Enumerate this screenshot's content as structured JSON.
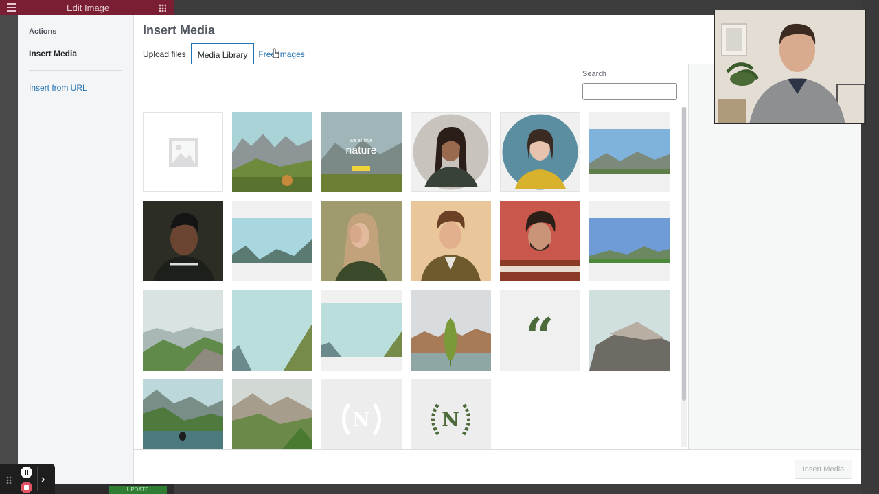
{
  "background_editor": {
    "title": "Edit Image",
    "update_label": "UPDATE"
  },
  "sidebar": {
    "section_title": "Actions",
    "active_item": "Insert Media",
    "items": [
      {
        "label": "Insert from URL"
      }
    ]
  },
  "header": {
    "title": "Insert Media"
  },
  "tabs": [
    {
      "label": "Upload files"
    },
    {
      "label": "Media Library"
    },
    {
      "label": "Free Images"
    }
  ],
  "search": {
    "label": "Search",
    "value": ""
  },
  "media_items": [
    {
      "name": "placeholder-image",
      "kind": "placeholder"
    },
    {
      "name": "mountain-valley",
      "kind": "landscape"
    },
    {
      "name": "we-all-love-nature-mockup",
      "kind": "mockup",
      "text_small": "we all love",
      "text_big": "nature"
    },
    {
      "name": "woman-portrait-circle",
      "kind": "portrait"
    },
    {
      "name": "woman-portrait-blue-circle",
      "kind": "portrait"
    },
    {
      "name": "mountain-sky-wide",
      "kind": "landscape"
    },
    {
      "name": "man-smiling-portrait",
      "kind": "portrait"
    },
    {
      "name": "mountain-range-wide",
      "kind": "landscape"
    },
    {
      "name": "woman-hand-face-portrait",
      "kind": "portrait"
    },
    {
      "name": "man-curly-hair-portrait",
      "kind": "portrait"
    },
    {
      "name": "man-beard-red-portrait",
      "kind": "portrait"
    },
    {
      "name": "green-hills-sky",
      "kind": "landscape"
    },
    {
      "name": "alpine-hills",
      "kind": "landscape"
    },
    {
      "name": "mountain-slopes-sky",
      "kind": "landscape"
    },
    {
      "name": "mountain-slopes-wide",
      "kind": "landscape"
    },
    {
      "name": "fern-leaf-lake",
      "kind": "landscape"
    },
    {
      "name": "quote-mark-graphic",
      "kind": "graphic",
      "text": "“"
    },
    {
      "name": "rocky-cliff-sea",
      "kind": "landscape"
    },
    {
      "name": "lake-mountains-person",
      "kind": "landscape"
    },
    {
      "name": "green-mountain-valley",
      "kind": "landscape"
    },
    {
      "name": "logo-n-white-wreath",
      "kind": "logo",
      "text": "N"
    },
    {
      "name": "logo-n-green-wreath",
      "kind": "logo",
      "text": "N"
    }
  ],
  "toolbar": {
    "insert_label": "Insert Media"
  },
  "colors": {
    "accent": "#2271b1",
    "logo_green": "#4d6b3a"
  },
  "icons": [
    "pause-icon",
    "stop-icon",
    "chevron-right-icon",
    "drag-handle-icon",
    "hamburger-icon",
    "grid-icon",
    "cursor-icon"
  ]
}
